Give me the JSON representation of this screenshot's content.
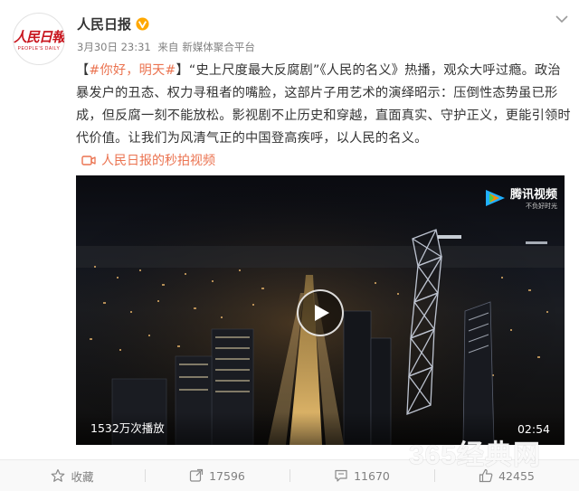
{
  "author": {
    "name": "人民日报",
    "avatar_logo_cn": "人民日報",
    "avatar_logo_en": "PEOPLE'S DAILY"
  },
  "meta": {
    "date": "3月30日 23:31",
    "source_prefix": "来自",
    "source": "新媒体聚合平台"
  },
  "post": {
    "bracket_open": "【",
    "hashtag": "#你好，明天#",
    "bracket_close": "】",
    "text": "“史上尺度最大反腐剧”《人民的名义》热播，观众大呼过瘾。政治暴发户的丑态、权力寻租者的嘴脸，这部片子用艺术的演绎昭示：压倒性态势虽已形成，但反腐一刻不能放松。影视剧不止历史和穿越，直面真实、守护正义，更能引领时代价值。让我们为风清气正的中国登高疾呼，以人民的名义。",
    "video_link": "人民日报的秒拍视频"
  },
  "video": {
    "play_count": "1532万次播放",
    "duration": "02:54",
    "logo_text": "腾讯视频",
    "logo_slogan": "不负好时光"
  },
  "actions": {
    "favorite": "收藏",
    "repost": "17596",
    "comment": "11670",
    "like": "42455"
  },
  "watermark": "365经典网",
  "colors": {
    "accent": "#eb7350",
    "text": "#333333",
    "muted": "#808080",
    "verified": "#ffa800"
  }
}
